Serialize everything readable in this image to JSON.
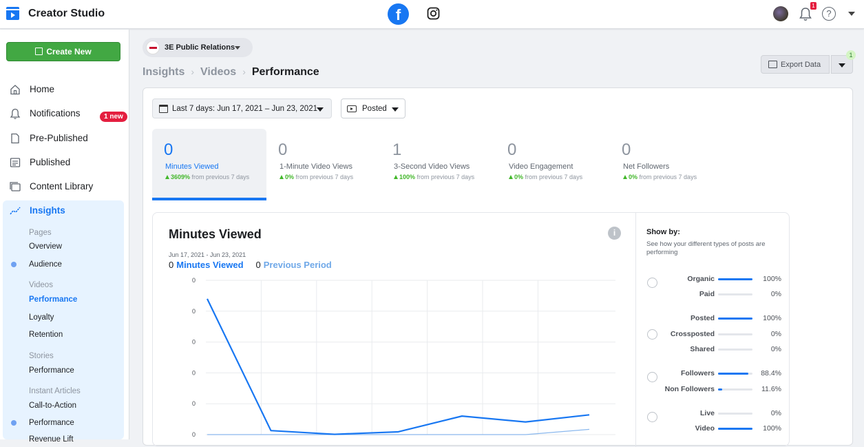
{
  "app": {
    "title": "Creator Studio"
  },
  "topbar": {
    "facebook_icon": "facebook-icon",
    "instagram_icon": "instagram-icon",
    "bell_badge": "1",
    "help_glyph": "?"
  },
  "sidebar": {
    "create_new": "Create New",
    "items": [
      {
        "label": "Home",
        "icon": "home-icon"
      },
      {
        "label": "Notifications",
        "icon": "bell-icon",
        "badge": "1 new"
      },
      {
        "label": "Pre-Published",
        "icon": "document-icon"
      },
      {
        "label": "Published",
        "icon": "published-list-icon"
      },
      {
        "label": "Content Library",
        "icon": "library-icon"
      },
      {
        "label": "Insights",
        "icon": "insights-icon"
      }
    ],
    "insights": {
      "pages_header": "Pages",
      "pages": [
        "Overview",
        "Audience"
      ],
      "videos_header": "Videos",
      "videos": [
        "Performance",
        "Loyalty",
        "Retention"
      ],
      "stories_header": "Stories",
      "stories": [
        "Performance"
      ],
      "articles_header": "Instant Articles",
      "articles": [
        "Call-to-Action",
        "Performance",
        "Revenue Lift"
      ]
    }
  },
  "page_selector": {
    "name": "3E Public Relations"
  },
  "breadcrumb": [
    "Insights",
    "Videos",
    "Performance"
  ],
  "export": {
    "label": "Export Data",
    "badge": "1"
  },
  "filters": {
    "date_range": "Last 7 days: Jun 17, 2021 – Jun 23, 2021",
    "post_type": "Posted"
  },
  "metrics": [
    {
      "value": "0",
      "label": "Minutes Viewed",
      "change": "3609%",
      "suffix": "from previous 7 days"
    },
    {
      "value": "0",
      "label": "1-Minute Video Views",
      "change": "0%",
      "suffix": "from previous 7 days"
    },
    {
      "value": "1",
      "label": "3-Second Video Views",
      "change": "100%",
      "suffix": "from previous 7 days"
    },
    {
      "value": "0",
      "label": "Video Engagement",
      "change": "0%",
      "suffix": "from previous 7 days"
    },
    {
      "value": "0",
      "label": "Net Followers",
      "change": "0%",
      "suffix": "from previous 7 days"
    }
  ],
  "chart": {
    "title": "Minutes Viewed",
    "range": "Jun 17, 2021 - Jun 23, 2021",
    "legend": [
      {
        "value": "0",
        "name": "Minutes Viewed"
      },
      {
        "value": "0",
        "name": "Previous Period"
      }
    ],
    "info_glyph": "i"
  },
  "chart_data": {
    "type": "line",
    "title": "Minutes Viewed",
    "x": [
      0,
      1,
      2,
      3,
      4,
      5,
      6
    ],
    "ytick_labels": [
      "0",
      "0",
      "0",
      "0",
      "0",
      "0"
    ],
    "grid": true,
    "series": [
      {
        "name": "Minutes Viewed",
        "color": "#1877f2",
        "values": [
          0.44,
          0.013,
          0.001,
          0.009,
          0.06,
          0.041,
          0.064
        ]
      },
      {
        "name": "Previous Period",
        "color": "#8ab8ee",
        "values": [
          0,
          0,
          0,
          0,
          0,
          0,
          0.017
        ]
      }
    ],
    "ylim": [
      0,
      0.5
    ]
  },
  "show_by": {
    "title": "Show by:",
    "description": "See how your different types of posts are performing",
    "groups": [
      {
        "rows": [
          {
            "label": "Organic",
            "pct": "100%",
            "frac": 1.0
          },
          {
            "label": "Paid",
            "pct": "0%",
            "frac": 0
          }
        ]
      },
      {
        "rows": [
          {
            "label": "Posted",
            "pct": "100%",
            "frac": 1.0
          },
          {
            "label": "Crossposted",
            "pct": "0%",
            "frac": 0
          },
          {
            "label": "Shared",
            "pct": "0%",
            "frac": 0
          }
        ]
      },
      {
        "rows": [
          {
            "label": "Followers",
            "pct": "88.4%",
            "frac": 0.884
          },
          {
            "label": "Non Followers",
            "pct": "11.6%",
            "frac": 0.116
          }
        ]
      },
      {
        "rows": [
          {
            "label": "Live",
            "pct": "0%",
            "frac": 0
          },
          {
            "label": "Video",
            "pct": "100%",
            "frac": 1.0
          }
        ]
      }
    ]
  }
}
